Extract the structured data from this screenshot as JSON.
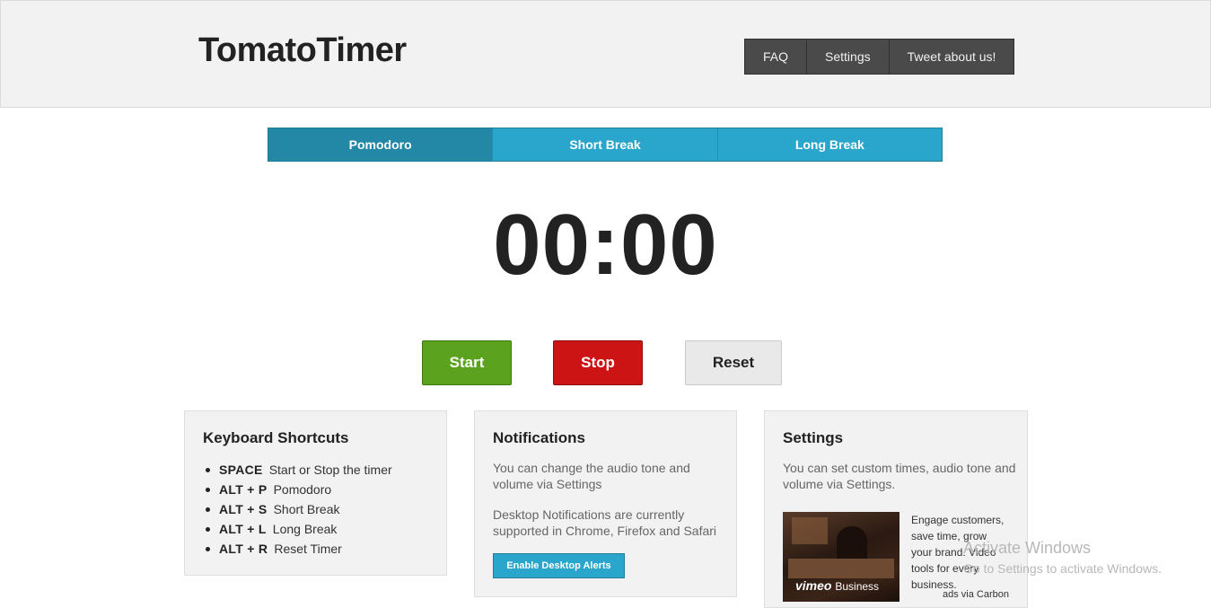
{
  "header": {
    "logo": "TomatoTimer",
    "nav": [
      "FAQ",
      "Settings",
      "Tweet about us!"
    ]
  },
  "tabs": [
    {
      "label": "Pomodoro",
      "active": true
    },
    {
      "label": "Short Break",
      "active": false
    },
    {
      "label": "Long Break",
      "active": false
    }
  ],
  "timer": {
    "display": "00:00"
  },
  "controls": {
    "start": "Start",
    "stop": "Stop",
    "reset": "Reset"
  },
  "shortcuts": {
    "title": "Keyboard Shortcuts",
    "items": [
      {
        "key": "SPACE",
        "desc": "Start or Stop the timer"
      },
      {
        "key": "ALT + P",
        "desc": "Pomodoro"
      },
      {
        "key": "ALT + S",
        "desc": "Short Break"
      },
      {
        "key": "ALT + L",
        "desc": "Long Break"
      },
      {
        "key": "ALT + R",
        "desc": "Reset Timer"
      }
    ]
  },
  "notifications": {
    "title": "Notifications",
    "text1": "You can change the audio tone and volume via Settings",
    "text2": "Desktop Notifications are currently supported in Chrome, Firefox and Safari",
    "button": "Enable Desktop Alerts"
  },
  "settings": {
    "title": "Settings",
    "text": "You can set custom times, audio tone and volume via Settings.",
    "ad": {
      "brand": "vimeo",
      "brand_suffix": "Business",
      "text": "Engage customers, save time, grow your brand. Video tools for every business.",
      "via": "ads via Carbon"
    }
  },
  "watermark": {
    "line1": "Activate Windows",
    "line2": "Go to Settings to activate Windows."
  },
  "colors": {
    "tab_blue": "#2aa5cb",
    "tab_active": "#2387a6",
    "start_green": "#5ba31f",
    "stop_red": "#cc1414",
    "nav_dark": "#4a4a4a"
  }
}
